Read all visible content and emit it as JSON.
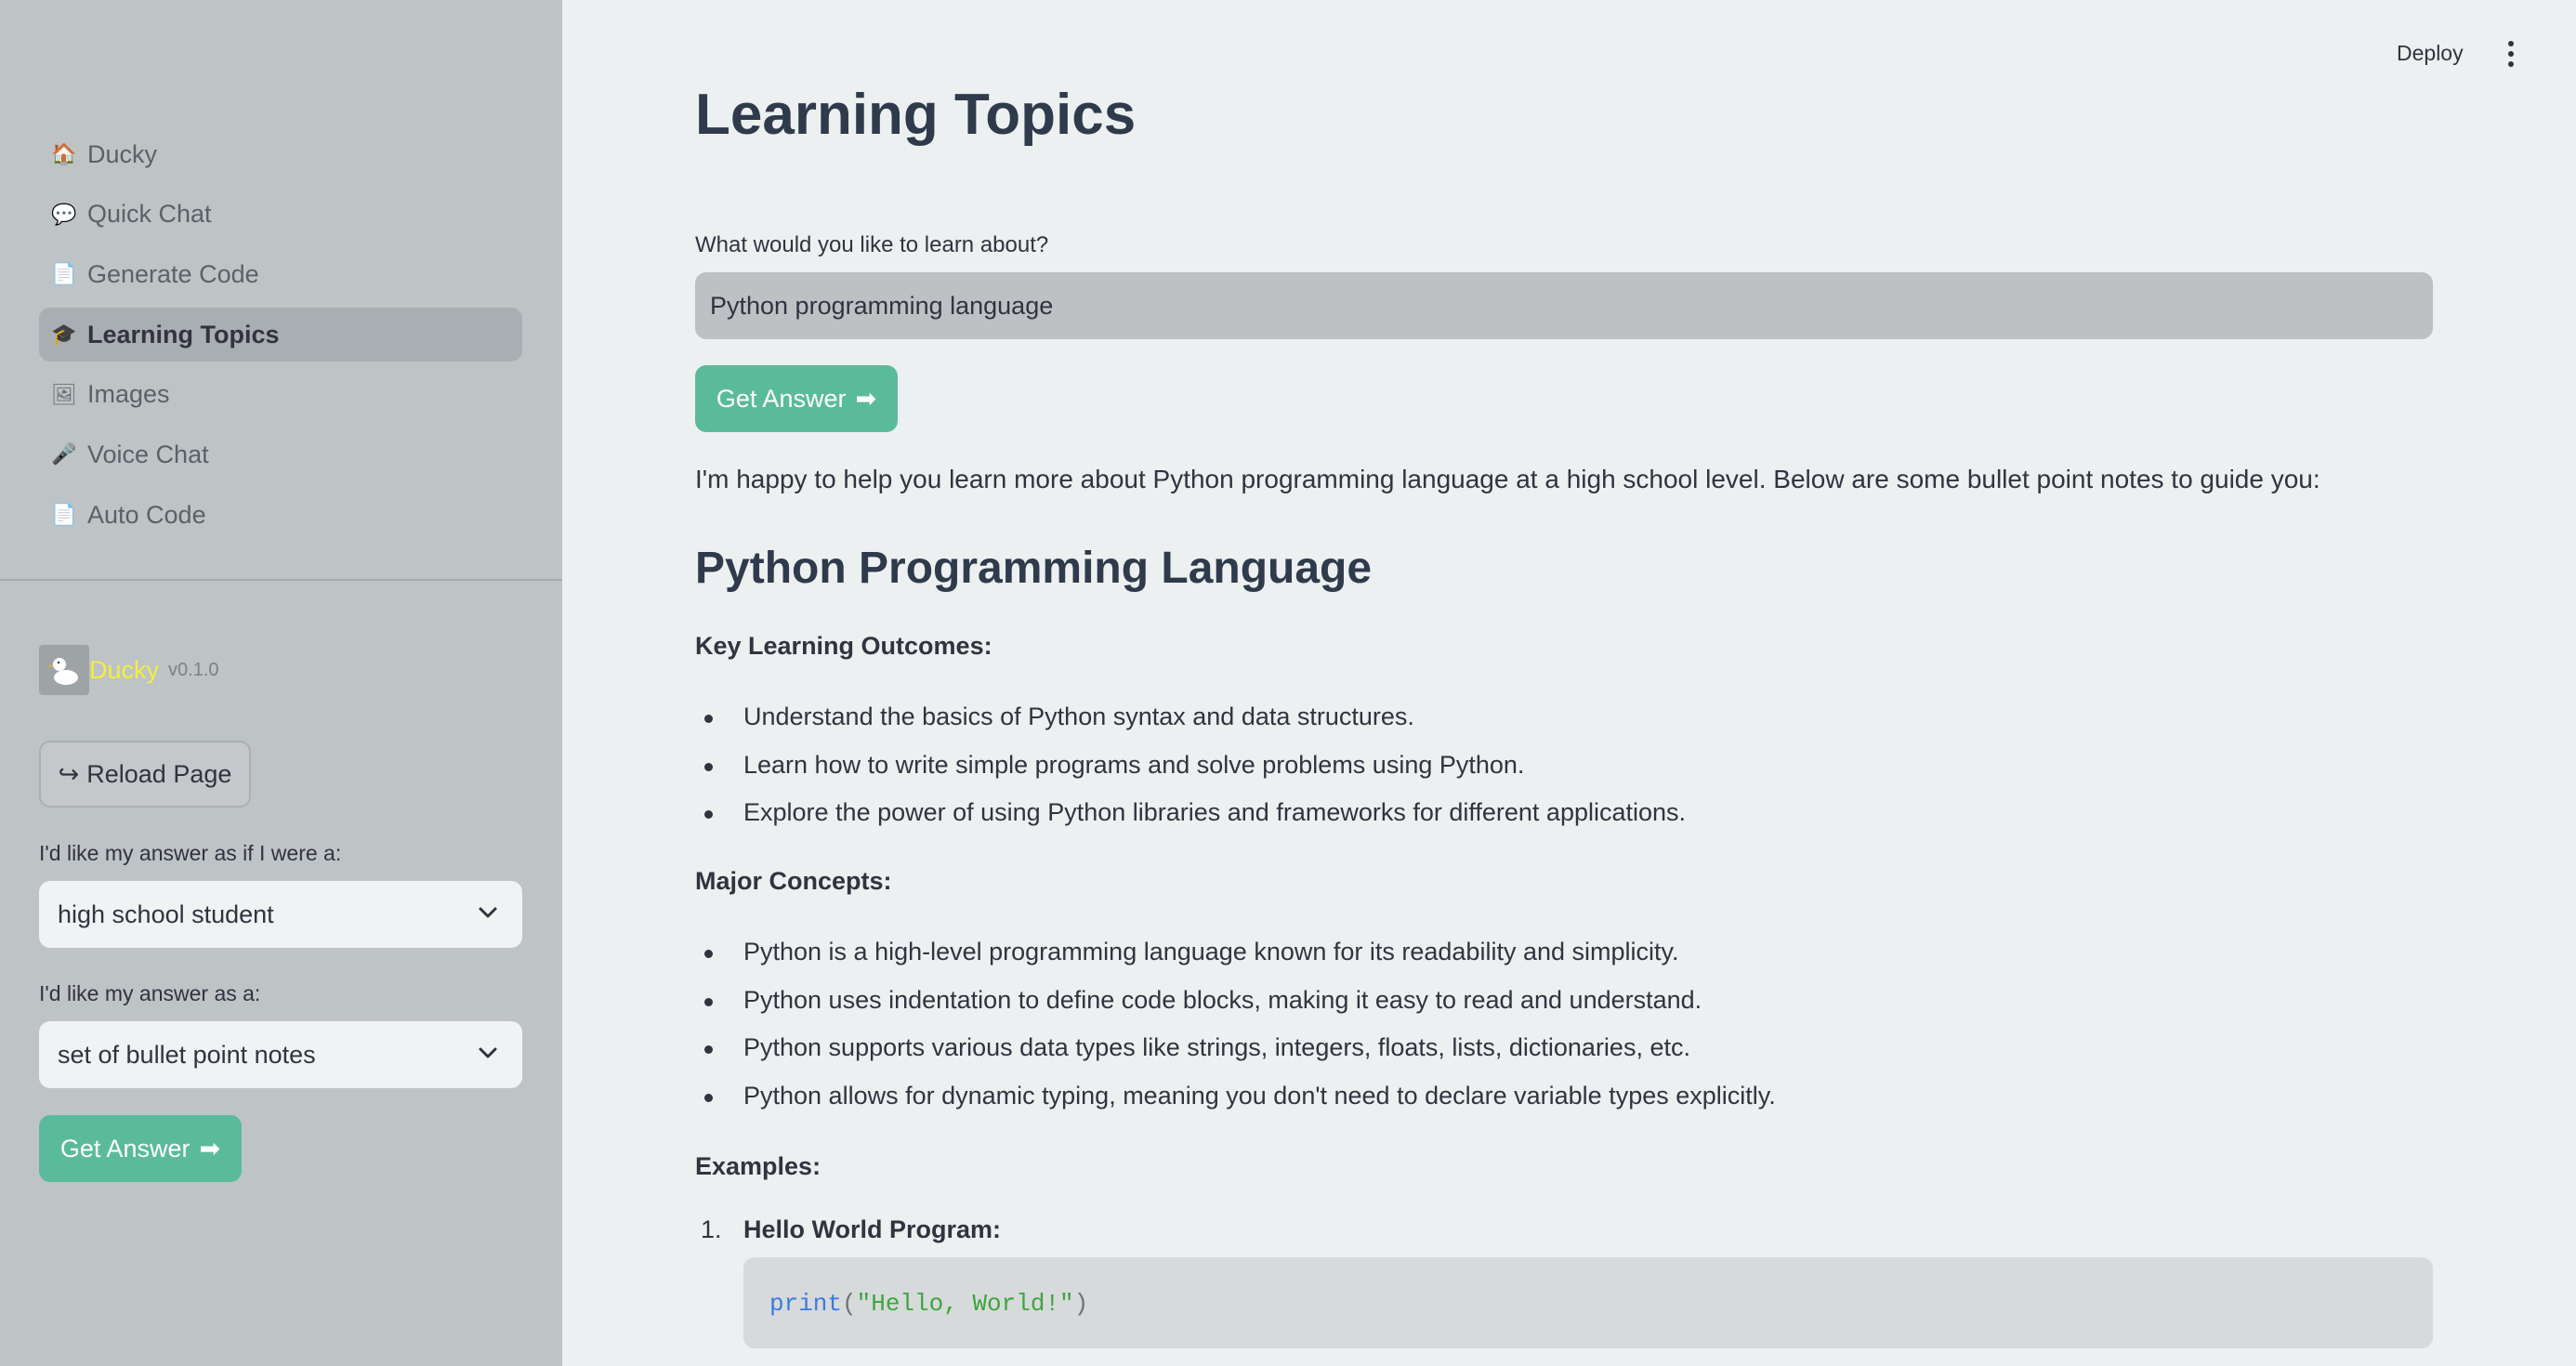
{
  "sidebar": {
    "nav": [
      {
        "label": "Ducky",
        "icon": "house-icon",
        "glyph": "🏠"
      },
      {
        "label": "Quick Chat",
        "icon": "speech-bubble-icon",
        "glyph": "💬"
      },
      {
        "label": "Generate Code",
        "icon": "document-icon",
        "glyph": "📄"
      },
      {
        "label": "Learning Topics",
        "icon": "graduation-cap-icon",
        "glyph": "🎓",
        "active": true
      },
      {
        "label": "Images",
        "icon": "picture-icon",
        "glyph": "🖼"
      },
      {
        "label": "Voice Chat",
        "icon": "microphone-icon",
        "glyph": "🎤"
      },
      {
        "label": "Auto Code",
        "icon": "document-icon",
        "glyph": "📄"
      }
    ],
    "brand_name": "Ducky",
    "brand_version": "v0.1.0",
    "reload_label": "Reload Page",
    "reload_glyph": "↪",
    "persona_label": "I'd like my answer as if I were a:",
    "persona_value": "high school student",
    "format_label": "I'd like my answer as a:",
    "format_value": "set of bullet point notes",
    "get_answer_label": "Get Answer",
    "get_answer_glyph": "➡"
  },
  "header": {
    "deploy_label": "Deploy"
  },
  "main": {
    "title": "Learning Topics",
    "question_label": "What would you like to learn about?",
    "question_value": "Python programming language",
    "get_answer_label": "Get Answer",
    "get_answer_glyph": "➡",
    "intro": "I'm happy to help you learn more about Python programming language at a high school level. Below are some bullet point notes to guide you:",
    "heading": "Python Programming Language",
    "outcomes_title": "Key Learning Outcomes:",
    "outcomes": [
      "Understand the basics of Python syntax and data structures.",
      "Learn how to write simple programs and solve problems using Python.",
      "Explore the power of using Python libraries and frameworks for different applications."
    ],
    "concepts_title": "Major Concepts:",
    "concepts": [
      "Python is a high-level programming language known for its readability and simplicity.",
      "Python uses indentation to define code blocks, making it easy to read and understand.",
      "Python supports various data types like strings, integers, floats, lists, dictionaries, etc.",
      "Python allows for dynamic typing, meaning you don't need to declare variable types explicitly."
    ],
    "examples_title": "Examples:",
    "example_number": "1.",
    "example_title": "Hello World Program:",
    "code_fn": "print",
    "code_open": "(",
    "code_str": "\"Hello, World!\"",
    "code_close": ")"
  },
  "colors": {
    "accent": "#5abb9b",
    "sidebar_bg": "#bec3c6",
    "main_bg": "#edf0f0",
    "brand_yellow": "#f3ee3c"
  }
}
